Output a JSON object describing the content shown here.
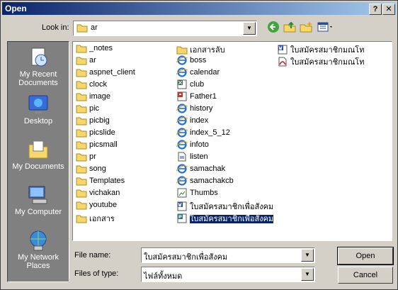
{
  "window": {
    "title": "Open",
    "help_glyph": "?",
    "close_glyph": "✕"
  },
  "toolbar": {
    "lookin_label": "Look in:",
    "lookin_value": "ar"
  },
  "places": [
    {
      "label": "My Recent Documents",
      "icon": "recent-documents-icon"
    },
    {
      "label": "Desktop",
      "icon": "desktop-icon"
    },
    {
      "label": "My Documents",
      "icon": "my-documents-icon"
    },
    {
      "label": "My Computer",
      "icon": "my-computer-icon"
    },
    {
      "label": "My Network Places",
      "icon": "network-places-icon"
    }
  ],
  "files": {
    "col1": [
      {
        "name": "_notes",
        "type": "folder"
      },
      {
        "name": "ar",
        "type": "folder"
      },
      {
        "name": "aspnet_client",
        "type": "folder"
      },
      {
        "name": "clock",
        "type": "folder"
      },
      {
        "name": "image",
        "type": "folder"
      },
      {
        "name": "pic",
        "type": "folder"
      },
      {
        "name": "picbig",
        "type": "folder"
      },
      {
        "name": "picslide",
        "type": "folder"
      },
      {
        "name": "picsmall",
        "type": "folder"
      },
      {
        "name": "pr",
        "type": "folder"
      },
      {
        "name": "song",
        "type": "folder"
      },
      {
        "name": "Templates",
        "type": "folder"
      },
      {
        "name": "vichakan",
        "type": "folder"
      },
      {
        "name": "youtube",
        "type": "folder"
      },
      {
        "name": "เอกสาร",
        "type": "folder"
      }
    ],
    "col2": [
      {
        "name": "เอกสารลับ",
        "type": "folder"
      },
      {
        "name": "boss",
        "type": "ie"
      },
      {
        "name": "calendar",
        "type": "ie"
      },
      {
        "name": "club",
        "type": "excel"
      },
      {
        "name": "Father1",
        "type": "ppt"
      },
      {
        "name": "history",
        "type": "ie"
      },
      {
        "name": "index",
        "type": "ie"
      },
      {
        "name": "index_5_12",
        "type": "ie"
      },
      {
        "name": "infoto",
        "type": "ie"
      },
      {
        "name": "listen",
        "type": "generic"
      },
      {
        "name": "samachak",
        "type": "ie"
      },
      {
        "name": "samachakcb",
        "type": "ie"
      },
      {
        "name": "Thumbs",
        "type": "thumbs"
      },
      {
        "name": "ใบสมัครสมาชิกเพื่อสังคม",
        "type": "word"
      },
      {
        "name": "ใบสมัครสมาชิกเพื่อสังคม",
        "type": "publisher",
        "selected": true
      }
    ],
    "col3": [
      {
        "name": "ใบสมัครสมาชิกมณโท",
        "type": "word"
      },
      {
        "name": "ใบสมัครสมาชิกมณโท",
        "type": "pdf"
      }
    ]
  },
  "bottom": {
    "filename_label": "File name:",
    "filename_value": "ใบสมัครสมาชิกเพื่อสังคม",
    "filetype_label": "Files of type:",
    "filetype_value": "ไฟล์ทั้งหมด",
    "open_label": "Open",
    "cancel_label": "Cancel"
  },
  "colors": {
    "titlebar": "#0a246a",
    "selection": "#0a246a",
    "dialog_bg": "#d4d0c8"
  }
}
